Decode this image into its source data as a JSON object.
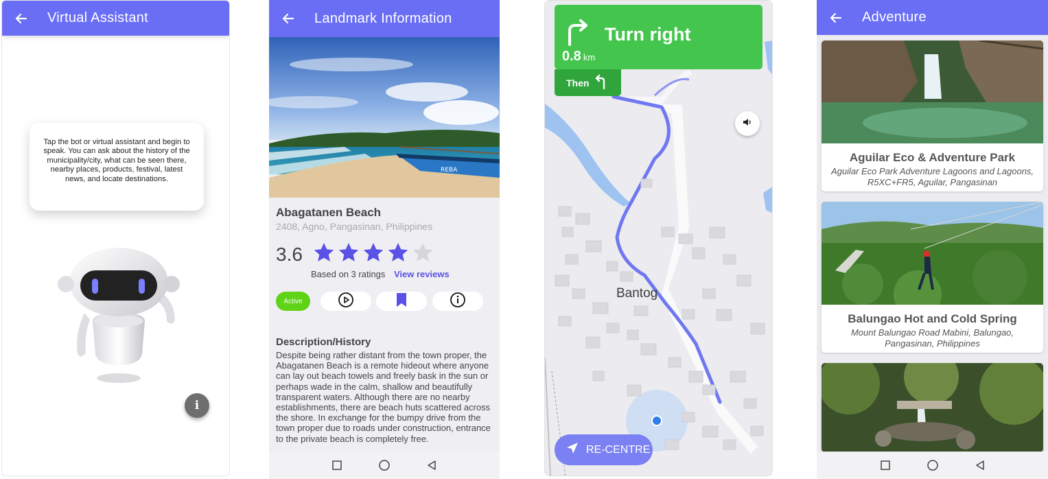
{
  "screens": {
    "virtual_assistant": {
      "title": "Virtual Assistant",
      "instructions": "Tap the bot or virtual assistant and begin to speak. You can ask about the history of the municipality/city, what can be seen there, nearby places, products, festival, latest news, and locate destinations.",
      "info_icon": "info-icon"
    },
    "landmark": {
      "title": "Landmark Information",
      "name": "Abagatanen Beach",
      "address": "2408, Agno, Pangasinan, Philippines",
      "rating": "3.6",
      "rating_value": 3.6,
      "rating_max": 5,
      "based_on": "Based on 3 ratings",
      "view_reviews": "View reviews",
      "status": "Active",
      "description_heading": "Description/History",
      "description": "Despite being rather distant from the town proper, the Abagatanen Beach is a remote hideout where anyone can lay out beach towels and freely bask in the sun or perhaps wade in the calm, shallow and beautifully transparent waters. Although there are no nearby establishments, there are beach huts scattered across the shore. In exchange for the bumpy drive from the town proper due to roads under construction, entrance to the private beach is completely free.",
      "accent": "#5a51e6"
    },
    "navigation": {
      "instruction": "Turn right",
      "distance": "0.8",
      "unit": "km",
      "then_label": "Then",
      "place_label": "Bantog",
      "recentre_label": "RE-CENTRE",
      "banner_color": "#44c64e"
    },
    "adventure": {
      "title": "Adventure",
      "cards": [
        {
          "title": "Aguilar Eco & Adventure Park",
          "address": "Aguilar Eco Park Adventure Lagoons and Lagoons, R5XC+FR5, Aguilar, Pangasinan"
        },
        {
          "title": "Balungao Hot and Cold Spring",
          "address": "Mount Balungao Road Mabini, Balungao, Pangasinan, Philippines"
        },
        {
          "title": "",
          "address": ""
        }
      ]
    }
  },
  "appbar_color": "#6a6ef5"
}
